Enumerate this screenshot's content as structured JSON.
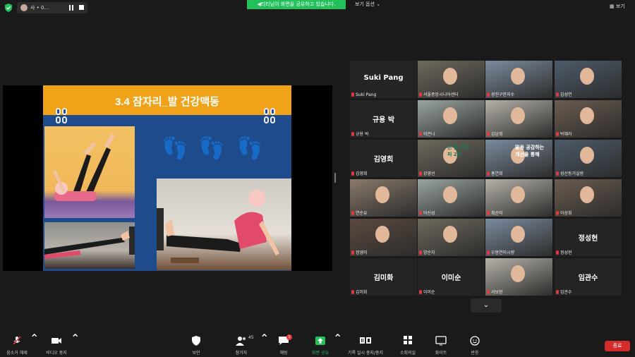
{
  "topbar": {
    "mini_title": "사 • 0...",
    "share_banner": "◀티티님이 화면을 공유하고 있습니다.",
    "view_options": "보기 옵션 ⌄",
    "right_label": "▦ 보기"
  },
  "slide": {
    "title": "3.4 잠자리_발 건강맥동",
    "feet_icons": [
      "👣",
      "👣",
      "👣"
    ]
  },
  "gallery": {
    "tiles": [
      {
        "name": "Suki Pang",
        "label": "Suki Pang",
        "video": false
      },
      {
        "name": "",
        "label": "서울중앙시니어센터",
        "video": true
      },
      {
        "name": "",
        "label": "광진구한지수",
        "video": true,
        "active": true
      },
      {
        "name": "",
        "label": "김성연",
        "video": true
      },
      {
        "name": "규용 박",
        "label": "규용 박",
        "video": false
      },
      {
        "name": "",
        "label": "이은나",
        "video": true
      },
      {
        "name": "",
        "label": "김남희",
        "video": true
      },
      {
        "name": "",
        "label": "박혜라",
        "video": true
      },
      {
        "name": "김영희",
        "label": "김영희",
        "video": false
      },
      {
        "name": "",
        "label": "강영선",
        "video": true,
        "slide_text": [
          "손 발 건강",
          "피 2탄"
        ]
      },
      {
        "name": "",
        "label": "홍연희",
        "video": true,
        "slide_text": [
          "말용 공감하는",
          "개선을 통해"
        ]
      },
      {
        "name": "",
        "label": "성산동거실랑",
        "video": true
      },
      {
        "name": "",
        "label": "연순유",
        "video": true
      },
      {
        "name": "",
        "label": "아신성",
        "video": true
      },
      {
        "name": "",
        "label": "최순미",
        "video": true
      },
      {
        "name": "",
        "label": "이상희",
        "video": true
      },
      {
        "name": "",
        "label": "정영미",
        "video": true
      },
      {
        "name": "",
        "label": "양순자",
        "video": true
      },
      {
        "name": "",
        "label": "우봉연미시량",
        "video": true
      },
      {
        "name": "정성현",
        "label": "정성현",
        "video": false
      },
      {
        "name": "김미화",
        "label": "김미화",
        "video": false
      },
      {
        "name": "이미순",
        "label": "이미순",
        "video": false
      },
      {
        "name": "",
        "label": "서보현",
        "video": true
      },
      {
        "name": "임관수",
        "label": "임관수",
        "video": false
      }
    ]
  },
  "toolbar": {
    "mute": "음소거 해제",
    "video": "비디오 중지",
    "security": "보안",
    "participants": "참가자",
    "participants_count": "45",
    "chat": "채팅",
    "chat_badge": "1",
    "share": "화면 공유",
    "rooms": "소회의실",
    "record": "기록 일시 중지/중지",
    "apps": "어플리케이션",
    "whiteboard": "화이트",
    "reactions": "반응",
    "end": "종료"
  },
  "colors": {
    "banner_green": "#23c15c",
    "active_speaker": "#a4d23a",
    "end_red": "#d42b2b",
    "slide_blue": "#1e4b8c",
    "slide_orange": "#f0a219"
  }
}
